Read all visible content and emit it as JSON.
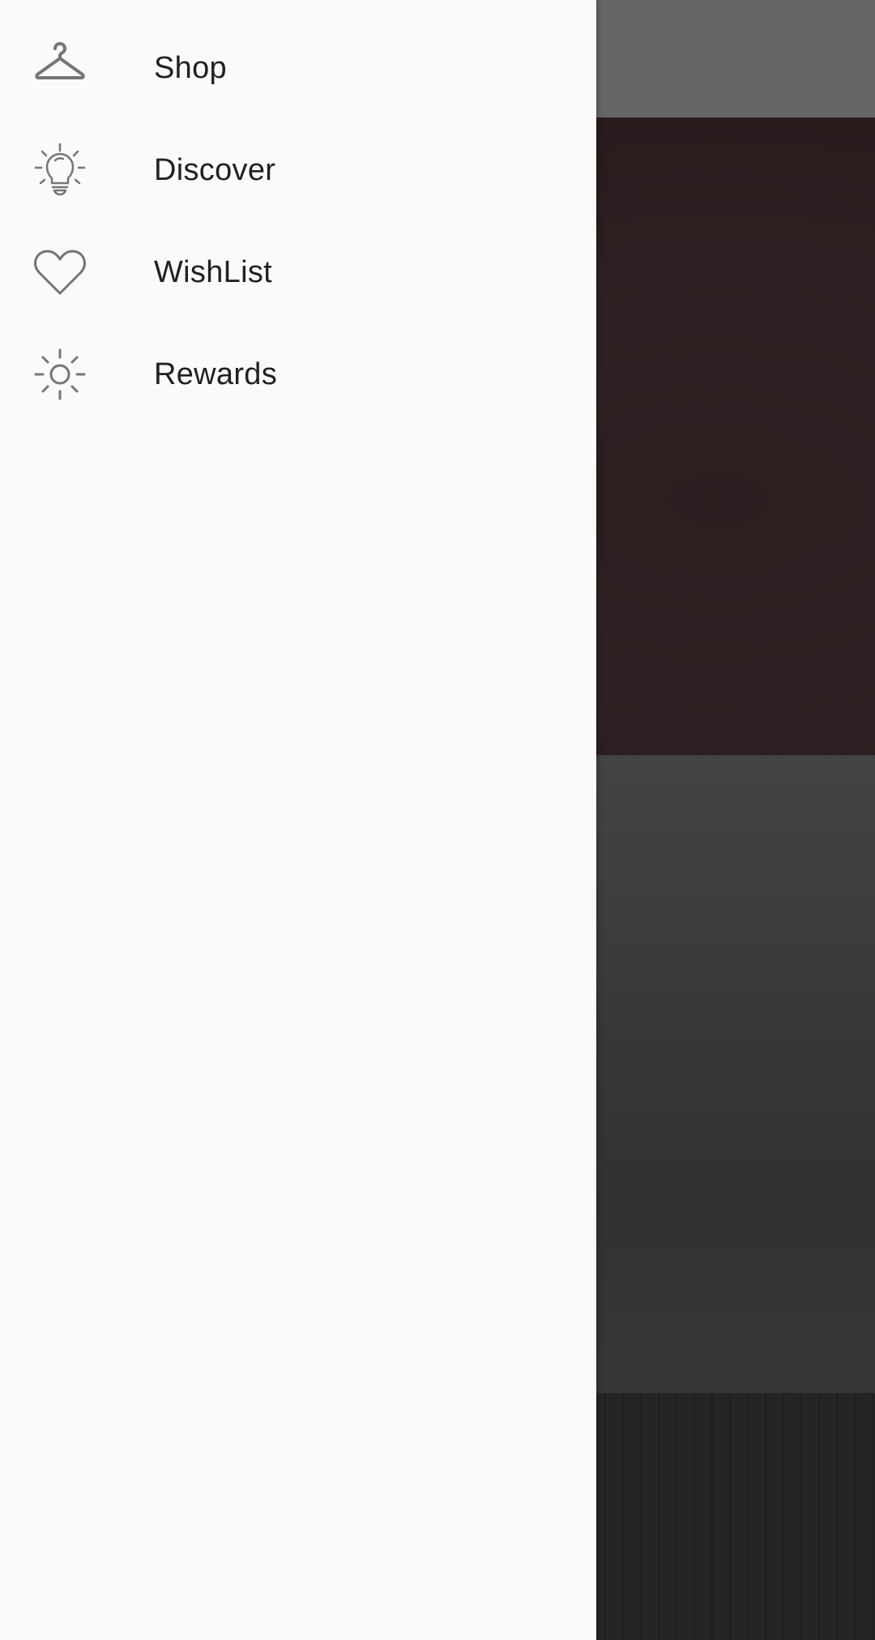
{
  "drawer": {
    "items": [
      {
        "label": "Shop",
        "icon": "hanger-icon"
      },
      {
        "label": "Discover",
        "icon": "lightbulb-icon"
      },
      {
        "label": "WishList",
        "icon": "heart-icon"
      },
      {
        "label": "Rewards",
        "icon": "sun-icon"
      }
    ]
  },
  "colors": {
    "drawer_background": "#fafafa",
    "label_text": "#212121",
    "icon_stroke": "#757575",
    "scrim": "rgba(0,0,0,0.6)"
  }
}
